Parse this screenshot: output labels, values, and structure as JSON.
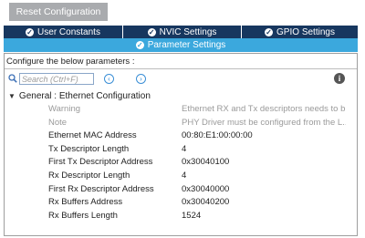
{
  "toolbar": {
    "reset_label": "Reset Configuration"
  },
  "tabs": {
    "row1": [
      {
        "label": "User Constants",
        "checked": true
      },
      {
        "label": "NVIC Settings",
        "checked": true
      },
      {
        "label": "GPIO Settings",
        "checked": true
      }
    ],
    "active": {
      "label": "Parameter Settings",
      "checked": true
    }
  },
  "panel": {
    "instruction": "Configure the below parameters :",
    "search": {
      "placeholder": "Search (Ctrl+F)",
      "value": ""
    },
    "group_title": "General : Ethernet Configuration",
    "params": [
      {
        "name": "Warning",
        "value": "Ethernet RX and Tx descriptors needs to b...",
        "muted": true
      },
      {
        "name": "Note",
        "value": "PHY Driver must be configured from the L...",
        "muted": true
      },
      {
        "name": "Ethernet MAC Address",
        "value": "00:80:E1:00:00:00",
        "muted": false
      },
      {
        "name": "Tx Descriptor Length",
        "value": "4",
        "muted": false
      },
      {
        "name": "First Tx Descriptor Address",
        "value": "0x30040100",
        "muted": false
      },
      {
        "name": "Rx Descriptor Length",
        "value": "4",
        "muted": false
      },
      {
        "name": "First Rx Descriptor Address",
        "value": "0x30040000",
        "muted": false
      },
      {
        "name": "Rx Buffers Address",
        "value": "0x30040200",
        "muted": false
      },
      {
        "name": "Rx Buffers Length",
        "value": "1524",
        "muted": false
      }
    ]
  },
  "colors": {
    "tab_dark": "#17375f",
    "tab_active": "#3ba8dd",
    "reset_button": "#a9abae"
  }
}
